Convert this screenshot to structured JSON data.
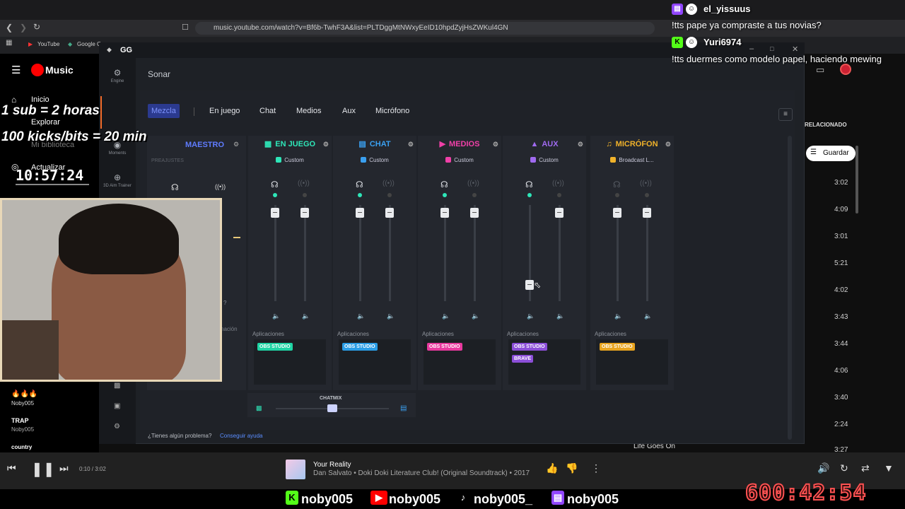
{
  "browser": {
    "url": "music.youtube.com/watch?v=Bf6b-TwhF3A&list=PLTDggMtNWxyEeID10hpdZyjHsZWKul4GN",
    "bookmarks": [
      "YouTube",
      "Google G"
    ]
  },
  "ytmusic": {
    "logo": "Music",
    "nav": [
      "Inicio",
      "Explorar",
      "Mi biblioteca",
      "Actualizar"
    ],
    "side_playlists": [
      {
        "title": "Noby005",
        "subtitle": ""
      },
      {
        "title": "TRAP",
        "subtitle": "Noby005"
      },
      {
        "title": "country",
        "subtitle": ""
      }
    ],
    "related_label": "RELACIONADO",
    "save_label": "Guardar",
    "durations": [
      "3:02",
      "4:09",
      "3:01",
      "5:21",
      "4:02",
      "3:43",
      "3:44",
      "4:06",
      "3:40",
      "2:24",
      "3:27"
    ],
    "next_track": "Life Goes On"
  },
  "gg": {
    "app_title": "GG",
    "rail": [
      {
        "label": "Engine",
        "icon": "engine-icon"
      },
      {
        "label": "Moments",
        "icon": "moments-icon"
      },
      {
        "label": "3D Aim Trainer",
        "icon": "aim-trainer-icon"
      }
    ],
    "section_title": "Sonar",
    "tabs": [
      "Mezcla",
      "En juego",
      "Chat",
      "Medios",
      "Aux",
      "Micrófono"
    ],
    "master": {
      "label": "MAESTRO",
      "presets_label": "PREAJUSTES",
      "notif_label": "nación"
    },
    "channels": [
      {
        "name": "EN JUEGO",
        "device": "Custom",
        "color": "#2ee6b8",
        "apps": [
          {
            "name": "OBS STUDIO",
            "color": "#1fd4a4"
          }
        ]
      },
      {
        "name": "CHAT",
        "device": "Custom",
        "color": "#3aa0f0",
        "apps": [
          {
            "name": "OBS STUDIO",
            "color": "#2a9de6"
          }
        ]
      },
      {
        "name": "MEDIOS",
        "device": "Custom",
        "color": "#f040a8",
        "apps": [
          {
            "name": "OBS STUDIO",
            "color": "#e8399e"
          }
        ]
      },
      {
        "name": "AUX",
        "device": "Custom",
        "color": "#a06af0",
        "apps": [
          {
            "name": "OBS STUDIO",
            "color": "#8c4fd8"
          },
          {
            "name": "BRAVE",
            "color": "#8c4fd8"
          }
        ]
      },
      {
        "name": "MICRÓFON",
        "device": "Broadcast L...",
        "color": "#f0b22a",
        "apps": [
          {
            "name": "OBS STUDIO",
            "color": "#e8a41f"
          }
        ]
      }
    ],
    "apps_label": "Aplicaciones",
    "chatmix_label": "CHATMIX",
    "help_text": "¿Tienes algún problema?",
    "help_link": "Conseguir ayuda"
  },
  "player": {
    "title": "Your Reality",
    "subtitle": "Dan Salvato • Doki Doki Literature Club! (Original Soundtrack) • 2017",
    "time": "0:10 / 3:02"
  },
  "overlay": {
    "stream_text_1": "1 sub = 2 horas",
    "stream_text_2": "100 kicks/bits = 20 min",
    "clock_small": "10:57:24",
    "timer_big": "600:42:54",
    "social": [
      "noby005",
      "noby005",
      "noby005_",
      "noby005"
    ],
    "chat": [
      {
        "user": "el_yissuus",
        "message": "!tts pape ya compraste a tus novias?"
      },
      {
        "user": "Yuri6974",
        "message": "!tts duermes como modelo papel, haciendo mewing"
      }
    ]
  }
}
